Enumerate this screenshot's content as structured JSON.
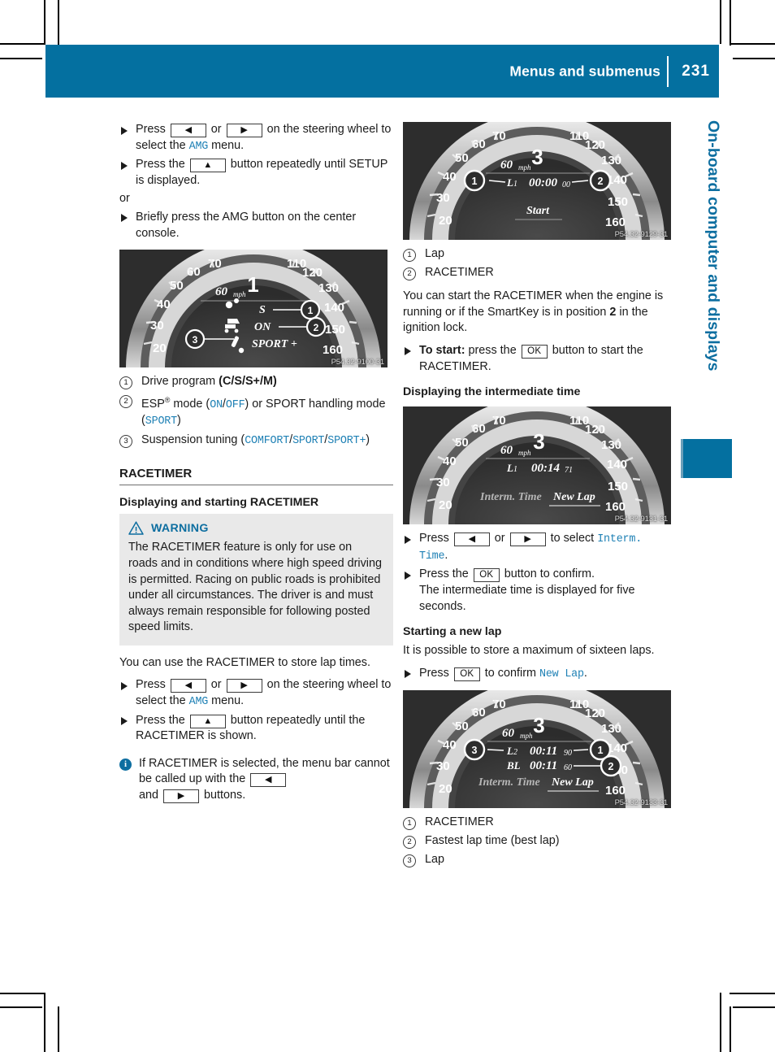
{
  "header": {
    "title": "Menus and submenus",
    "page_number": "231"
  },
  "side_tab": {
    "label": "On-board computer and displays",
    "color": "#0470a0"
  },
  "left_column": {
    "steps_top": [
      {
        "segments": [
          {
            "t": "text",
            "v": "Press "
          },
          {
            "t": "key",
            "v": "◀"
          },
          {
            "t": "text",
            "v": " or "
          },
          {
            "t": "key",
            "v": "▶"
          },
          {
            "t": "text",
            "v": " on the steering wheel to select the "
          },
          {
            "t": "mono",
            "v": "AMG"
          },
          {
            "t": "text",
            "v": " menu."
          }
        ]
      },
      {
        "segments": [
          {
            "t": "text",
            "v": "Press the "
          },
          {
            "t": "key",
            "v": "▲"
          },
          {
            "t": "text",
            "v": " button repeatedly until SETUP is displayed."
          }
        ]
      }
    ],
    "or_label": "or",
    "step_or": {
      "segments": [
        {
          "t": "text",
          "v": "Briefly press the AMG button on the center console."
        }
      ]
    },
    "figure1": {
      "gear": "1",
      "speed": "60",
      "unit": "mph",
      "rows": [
        "S",
        "ON",
        "SPORT +"
      ],
      "code": "P54.32-9100-31",
      "callouts": [
        "1",
        "2",
        "3"
      ],
      "ticks_left": [
        "20",
        "30",
        "40",
        "50",
        "60",
        "70"
      ],
      "ticks_right": [
        "110",
        "120",
        "130",
        "140",
        "150",
        "160"
      ]
    },
    "legend1": [
      {
        "num": "1",
        "segments": [
          {
            "t": "text",
            "v": "Drive program "
          },
          {
            "t": "bold",
            "v": "(C/S/S+/M)"
          }
        ]
      },
      {
        "num": "2",
        "segments": [
          {
            "t": "text",
            "v": "ESP"
          },
          {
            "t": "sup",
            "v": "®"
          },
          {
            "t": "text",
            "v": " mode ("
          },
          {
            "t": "mono",
            "v": "ON"
          },
          {
            "t": "text",
            "v": "/"
          },
          {
            "t": "mono",
            "v": "OFF"
          },
          {
            "t": "text",
            "v": ") or SPORT handling mode ("
          },
          {
            "t": "mono",
            "v": "SPORT"
          },
          {
            "t": "text",
            "v": ")"
          }
        ]
      },
      {
        "num": "3",
        "segments": [
          {
            "t": "text",
            "v": "Suspension tuning ("
          },
          {
            "t": "mono",
            "v": "COMFORT"
          },
          {
            "t": "text",
            "v": "/"
          },
          {
            "t": "mono",
            "v": "SPORT"
          },
          {
            "t": "text",
            "v": "/"
          },
          {
            "t": "mono",
            "v": "SPORT+"
          },
          {
            "t": "text",
            "v": ")"
          }
        ]
      }
    ],
    "section_heading": "RACETIMER",
    "sub_heading": "Displaying and starting RACETIMER",
    "warning": {
      "label": "WARNING",
      "body": "The RACETIMER feature is only for use on roads and in conditions where high speed driving is permitted. Racing on public roads is prohibited under all circumstances. The driver is and must always remain responsible for following posted speed limits.",
      "color": "#0d6ea0"
    },
    "intro": "You can use the RACETIMER to store lap times.",
    "steps_bottom": [
      {
        "segments": [
          {
            "t": "text",
            "v": "Press "
          },
          {
            "t": "key",
            "v": "◀"
          },
          {
            "t": "text",
            "v": " or "
          },
          {
            "t": "key",
            "v": "▶"
          },
          {
            "t": "text",
            "v": " on the steering wheel to select the "
          },
          {
            "t": "mono",
            "v": "AMG"
          },
          {
            "t": "text",
            "v": " menu."
          }
        ]
      },
      {
        "segments": [
          {
            "t": "text",
            "v": "Press the "
          },
          {
            "t": "key",
            "v": "▲"
          },
          {
            "t": "text",
            "v": " button repeatedly until the RACETIMER is shown."
          }
        ]
      }
    ],
    "note": {
      "segments": [
        {
          "t": "text",
          "v": "If RACETIMER is selected, the menu bar cannot be called up with the "
        },
        {
          "t": "key",
          "v": "◀"
        },
        {
          "t": "break",
          "v": ""
        },
        {
          "t": "text",
          "v": "and "
        },
        {
          "t": "key",
          "v": "▶"
        },
        {
          "t": "text",
          "v": " buttons."
        }
      ]
    }
  },
  "right_column": {
    "figure2": {
      "gear": "3",
      "speed": "60",
      "unit": "mph",
      "lap_label": "L1",
      "time": "00:00",
      "time_frac": "00",
      "action": "Start",
      "code": "P54.32-9129-31",
      "callouts": [
        "1",
        "2"
      ]
    },
    "legend2": [
      {
        "num": "1",
        "segments": [
          {
            "t": "text",
            "v": "Lap"
          }
        ]
      },
      {
        "num": "2",
        "segments": [
          {
            "t": "text",
            "v": "RACETIMER"
          }
        ]
      }
    ],
    "para1": {
      "segments": [
        {
          "t": "text",
          "v": "You can start the RACETIMER when the engine is running or if the SmartKey is in position "
        },
        {
          "t": "bold",
          "v": "2"
        },
        {
          "t": "text",
          "v": " in the ignition lock."
        }
      ]
    },
    "step_start": {
      "segments": [
        {
          "t": "bold",
          "v": "To start:"
        },
        {
          "t": "text",
          "v": " press the "
        },
        {
          "t": "key",
          "v": "OK"
        },
        {
          "t": "text",
          "v": " button to start the RACETIMER."
        }
      ]
    },
    "heading_interm": "Displaying the intermediate time",
    "figure3": {
      "gear": "3",
      "speed": "60",
      "unit": "mph",
      "lap_label": "L1",
      "time": "00:14",
      "time_frac": "71",
      "option_left": "Interm. Time",
      "option_right": "New Lap",
      "code": "P54.32-9131-31"
    },
    "steps_interm": [
      {
        "segments": [
          {
            "t": "text",
            "v": "Press "
          },
          {
            "t": "key",
            "v": "◀"
          },
          {
            "t": "text",
            "v": " or "
          },
          {
            "t": "key",
            "v": "▶"
          },
          {
            "t": "text",
            "v": " to select "
          },
          {
            "t": "mono",
            "v": "Interm. Time"
          },
          {
            "t": "text",
            "v": "."
          }
        ]
      },
      {
        "segments": [
          {
            "t": "text",
            "v": "Press the "
          },
          {
            "t": "key",
            "v": "OK"
          },
          {
            "t": "text",
            "v": " button to confirm."
          },
          {
            "t": "break",
            "v": ""
          },
          {
            "t": "text",
            "v": "The intermediate time is displayed for five seconds."
          }
        ]
      }
    ],
    "heading_newlap": "Starting a new lap",
    "para2": "It is possible to store a maximum of sixteen laps.",
    "step_newlap": {
      "segments": [
        {
          "t": "text",
          "v": "Press "
        },
        {
          "t": "key",
          "v": "OK"
        },
        {
          "t": "text",
          "v": " to confirm "
        },
        {
          "t": "mono",
          "v": "New Lap"
        },
        {
          "t": "text",
          "v": "."
        }
      ]
    },
    "figure4": {
      "gear": "3",
      "speed": "60",
      "unit": "mph",
      "lap_label": "L2",
      "time": "00:11",
      "time_frac": "90",
      "best_label": "BL",
      "best_time": "00:11",
      "best_frac": "60",
      "option_left": "Interm. Time",
      "option_right": "New Lap",
      "code": "P54.32-9133-31",
      "callouts": [
        "1",
        "2",
        "3"
      ]
    },
    "legend3": [
      {
        "num": "1",
        "segments": [
          {
            "t": "text",
            "v": "RACETIMER"
          }
        ]
      },
      {
        "num": "2",
        "segments": [
          {
            "t": "text",
            "v": "Fastest lap time (best lap)"
          }
        ]
      },
      {
        "num": "3",
        "segments": [
          {
            "t": "text",
            "v": "Lap"
          }
        ]
      }
    ]
  }
}
